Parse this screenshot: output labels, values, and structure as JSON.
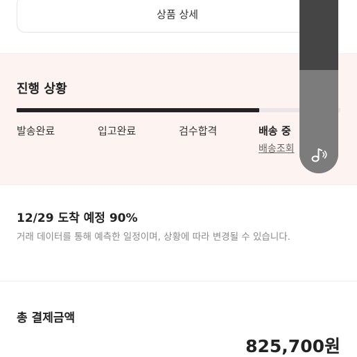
{
  "detail_button": {
    "label": "상품 상세"
  },
  "progress": {
    "title": "진행 상황",
    "fill_fraction": 0.75,
    "steps": [
      {
        "label": "발송완료",
        "active": false
      },
      {
        "label": "입고완료",
        "active": false
      },
      {
        "label": "검수합격",
        "active": false
      },
      {
        "label": "배송 중",
        "active": true
      }
    ],
    "tracking_link": "배송조회"
  },
  "player": {
    "icon": "music-note-icon"
  },
  "eta": {
    "title": "12/29 도착 예정 90%",
    "description": "거래 데이터를 통해 예측한 일정이며, 상황에 따라 변경될 수 있습니다."
  },
  "total": {
    "label": "총 결제금액",
    "amount": "825,700원"
  }
}
